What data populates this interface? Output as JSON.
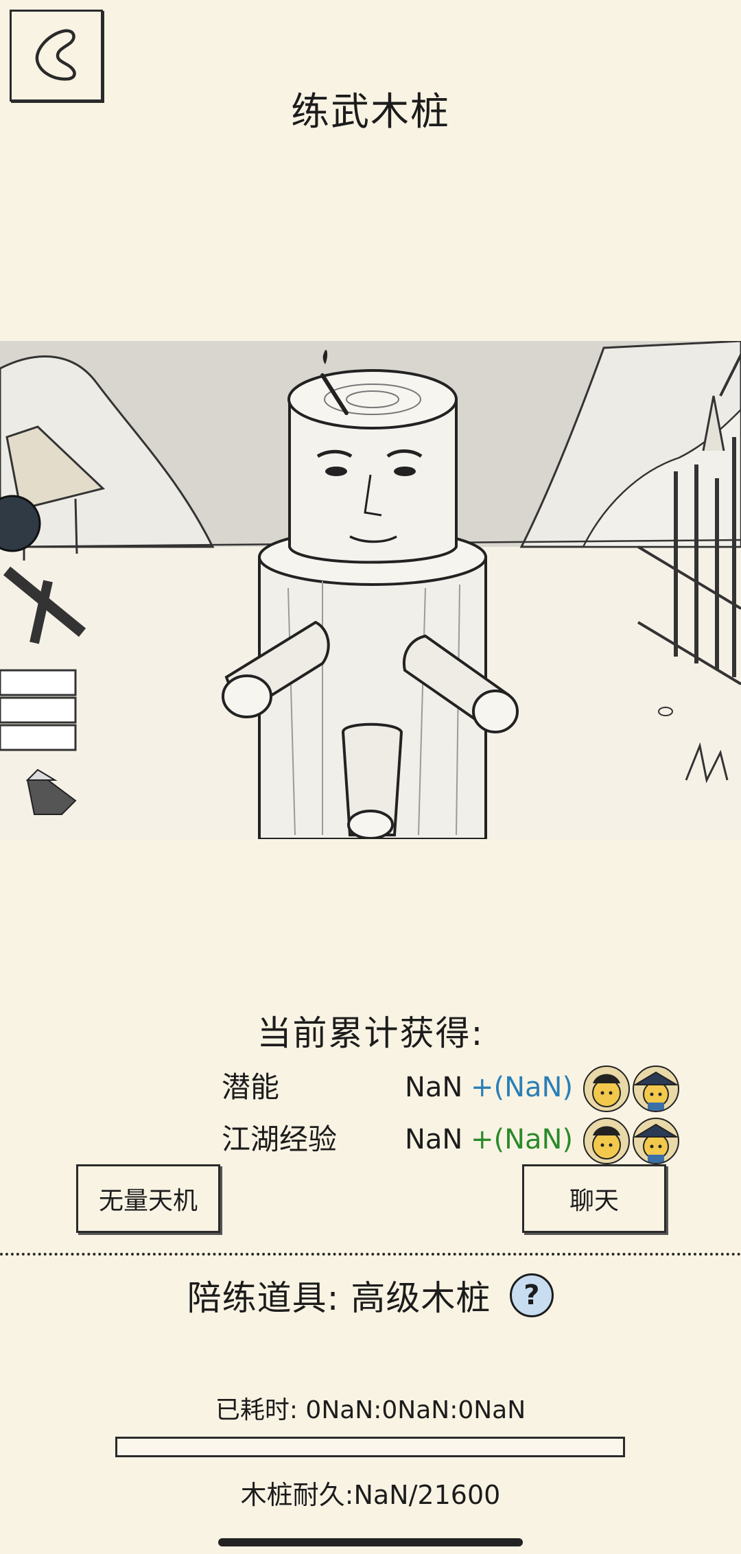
{
  "header": {
    "title": "练武木桩",
    "back_icon": "back-arrow-icon"
  },
  "scene": {
    "description_icon": "wooden-training-dummy-illustration"
  },
  "gains": {
    "title": "当前累计获得:",
    "rows": [
      {
        "label": "潜能",
        "value": "NaN",
        "bonus": "+(NaN)",
        "bonus_color": "#2a7fb5"
      },
      {
        "label": "江湖经验",
        "value": "NaN",
        "bonus": "+(NaN)",
        "bonus_color": "#2a8a2a"
      }
    ]
  },
  "buttons": {
    "left_label": "无量天机",
    "right_label": "聊天"
  },
  "tool": {
    "text": "陪练道具: 高级木桩",
    "help_icon": "?"
  },
  "timer": {
    "text": "已耗时: 0NaN:0NaN:0NaN"
  },
  "durability": {
    "text": "木桩耐久:NaN/21600",
    "progress_percent": 0
  }
}
